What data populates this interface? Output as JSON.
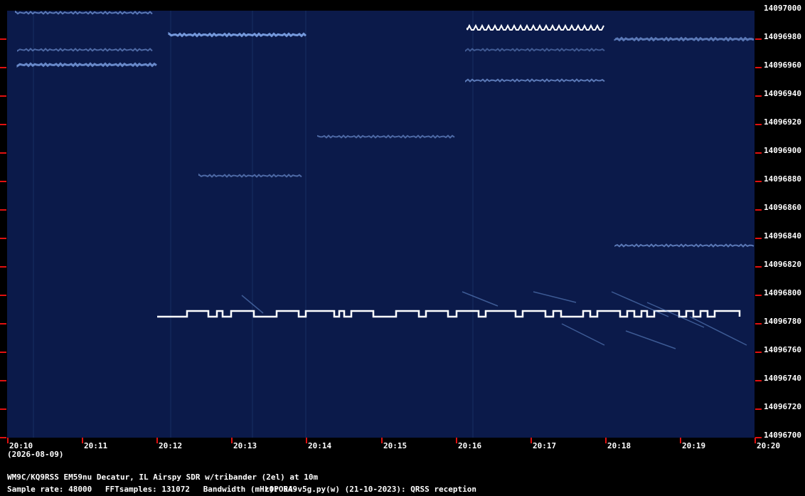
{
  "y_axis": {
    "unit": "Hz",
    "labels": [
      "14097000",
      "14096980",
      "14096960",
      "14096940",
      "14096920",
      "14096900",
      "14096880",
      "14096860",
      "14096840",
      "14096820",
      "14096800",
      "14096780",
      "14096760",
      "14096740",
      "14096720",
      "14096700"
    ]
  },
  "x_axis": {
    "labels": [
      "20:10",
      "20:11",
      "20:12",
      "20:13",
      "20:14",
      "20:15",
      "20:16",
      "20:17",
      "20:18",
      "20:19",
      "20:20"
    ],
    "date": "(2026-08-09)"
  },
  "station": "WM9C/KQ9RSS EM59nu Decatur, IL  Airspy SDR w/tribander (2el) at 10m",
  "params": {
    "sample_rate": "Sample rate: 48000",
    "fft_samples": "FFTsamples: 131072",
    "bandwidth": "Bandwidth (mHz): 549"
  },
  "software": "LOPORA-v5g.py(w) (21-10-2023): QRSS reception",
  "colors": {
    "background": "#0b1a4a",
    "signal": "#ffffff",
    "tick": "#e01010"
  }
}
